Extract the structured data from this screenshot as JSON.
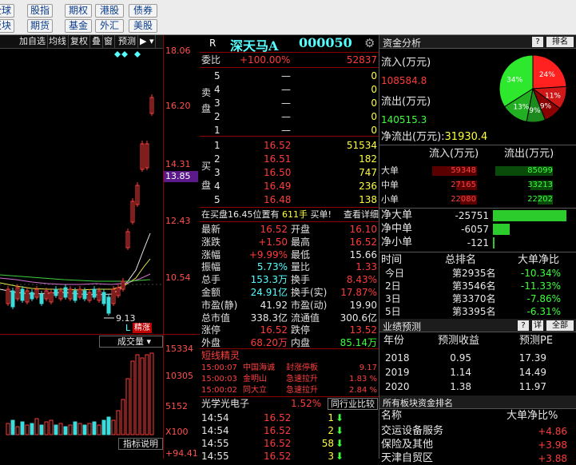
{
  "topnav": {
    "row1": [
      "全球",
      "股指",
      "期权",
      "港股",
      "债券"
    ],
    "row2": [
      "板块",
      "期货",
      "基金",
      "外汇",
      "美股"
    ]
  },
  "chart_toolbar": [
    "加自选",
    "均线",
    "复权",
    "叠",
    "窗",
    "预测"
  ],
  "price_axis": [
    "18.06",
    "16.20",
    "14.31",
    "13.85",
    "12.43",
    "10.54"
  ],
  "low_marker": "9.13",
  "chart_tags": {
    "L": "L",
    "up": "精",
    "down": "涨"
  },
  "volume": {
    "label": "成交量",
    "axis": [
      "15334",
      "10305",
      "5152",
      "X100",
      "+94.41"
    ],
    "indicator": "指标说明"
  },
  "quote": {
    "r": "R",
    "name": "深天马A",
    "code": "000050",
    "weibi_label": "委比",
    "weibi": "+100.00%",
    "weicha": "52837",
    "sell_label": [
      "卖",
      "盘"
    ],
    "buy_label": [
      "买",
      "盘"
    ],
    "sell": [
      {
        "n": "5",
        "p": "—",
        "v": "0"
      },
      {
        "n": "4",
        "p": "—",
        "v": "0"
      },
      {
        "n": "3",
        "p": "—",
        "v": "0"
      },
      {
        "n": "2",
        "p": "—",
        "v": "0"
      },
      {
        "n": "1",
        "p": "—",
        "v": "0"
      }
    ],
    "buy": [
      {
        "n": "1",
        "p": "16.52",
        "v": "51534"
      },
      {
        "n": "2",
        "p": "16.51",
        "v": "182"
      },
      {
        "n": "3",
        "p": "16.50",
        "v": "747"
      },
      {
        "n": "4",
        "p": "16.49",
        "p2": "",
        "v": "236"
      },
      {
        "n": "5",
        "p": "16.48",
        "v": "138"
      }
    ],
    "note": "在买盘16.45位置有",
    "note_v": "611手",
    "note_tail": "买单!",
    "note_link": "查看详细"
  },
  "stats": [
    [
      "最新",
      "16.52",
      "开盘",
      "16.10"
    ],
    [
      "涨跌",
      "+1.50",
      "最高",
      "16.52"
    ],
    [
      "涨幅",
      "+9.99%",
      "最低",
      "15.66"
    ],
    [
      "振幅",
      "5.73%",
      "量比",
      "1.33"
    ],
    [
      "总手",
      "153.3万",
      "换手",
      "8.43%"
    ],
    [
      "金额",
      "24.91亿",
      "换手(实)",
      "17.87%"
    ],
    [
      "市盈(静)",
      "41.92",
      "市盈(动)",
      "19.90"
    ],
    [
      "总市值",
      "338.3亿",
      "流通值",
      "300.6亿"
    ],
    [
      "涨停",
      "16.52",
      "跌停",
      "13.52"
    ],
    [
      "外盘",
      "68.20万",
      "内盘",
      "85.14万"
    ]
  ],
  "news": {
    "title": "短线精灵",
    "items": [
      [
        "15:00:07",
        "中国海诚",
        "封涨停板",
        "9.17"
      ],
      [
        "15:00:03",
        "金明山",
        "急速拉升",
        "1.83 %"
      ],
      [
        "15:00:02",
        "同大立",
        "急速拉升",
        "2.84 %"
      ]
    ]
  },
  "sector": {
    "name": "光学光电子",
    "pct": "1.52%",
    "btn": "同行业比较"
  },
  "ticks": [
    [
      "14:54",
      "16.52",
      "1"
    ],
    [
      "14:54",
      "16.52",
      "2"
    ],
    [
      "14:55",
      "16.52",
      "58"
    ],
    [
      "14:55",
      "16.52",
      "3"
    ]
  ],
  "fund": {
    "title": "资金分析",
    "rank_btn": "排名",
    "q": "?",
    "in_label": "流入(万元)",
    "in_val": "108584.8",
    "out_label": "流出(万元)",
    "out_val": "140515.3",
    "net_label": "净流出(万元):",
    "net_val": "31930.4",
    "pie": [
      {
        "label": "24%",
        "value": 24,
        "color": "#ff2020"
      },
      {
        "label": "11%",
        "value": 11,
        "color": "#d01818"
      },
      {
        "label": "9%",
        "value": 9,
        "color": "#8b0000"
      },
      {
        "label": "9%",
        "value": 9,
        "color": "#1c8a1c"
      },
      {
        "label": "13%",
        "value": 13,
        "color": "#22b022"
      },
      {
        "label": "34%",
        "value": 34,
        "color": "#2ee82e"
      }
    ],
    "cols": [
      "流入(万元)",
      "流出(万元)"
    ],
    "sizes": [
      {
        "name": "大单",
        "in": "59348",
        "out": "85099",
        "inf": 0.7,
        "outf": 1.0
      },
      {
        "name": "中单",
        "in": "27165",
        "out": "33213",
        "inf": 0.32,
        "outf": 0.39
      },
      {
        "name": "小单",
        "in": "22080",
        "out": "22202",
        "inf": 0.26,
        "outf": 0.26
      }
    ],
    "net": [
      {
        "name": "净大单",
        "v": "-25751",
        "f": 1.0
      },
      {
        "name": "净中单",
        "v": "-6057",
        "f": 0.23
      },
      {
        "name": "净小单",
        "v": "-121",
        "f": 0.02
      }
    ],
    "hist_cols": [
      "时间",
      "总排名",
      "大单净比"
    ],
    "hist": [
      [
        "今日",
        "第2935名",
        "-10.34%"
      ],
      [
        "2日",
        "第3546名",
        "-11.33%"
      ],
      [
        "3日",
        "第3370名",
        "-7.86%"
      ],
      [
        "5日",
        "第3395名",
        "-6.31%"
      ]
    ]
  },
  "forecast": {
    "title": "业绩预测",
    "q": "?",
    "btn1": "详",
    "btn2": "全部",
    "cols": [
      "年份",
      "预测收益",
      "预测PE"
    ],
    "rows": [
      [
        "2018",
        "0.95",
        "17.39"
      ],
      [
        "2019",
        "1.14",
        "14.49"
      ],
      [
        "2020",
        "1.38",
        "11.97"
      ]
    ]
  },
  "board": {
    "title": "所有板块资金排名",
    "cols": [
      "名称",
      "大单净比%"
    ],
    "rows": [
      [
        "交运设备服务",
        "+4.86"
      ],
      [
        "保险及其他",
        "+3.98"
      ],
      [
        "天津自贸区",
        "+3.88"
      ]
    ]
  }
}
